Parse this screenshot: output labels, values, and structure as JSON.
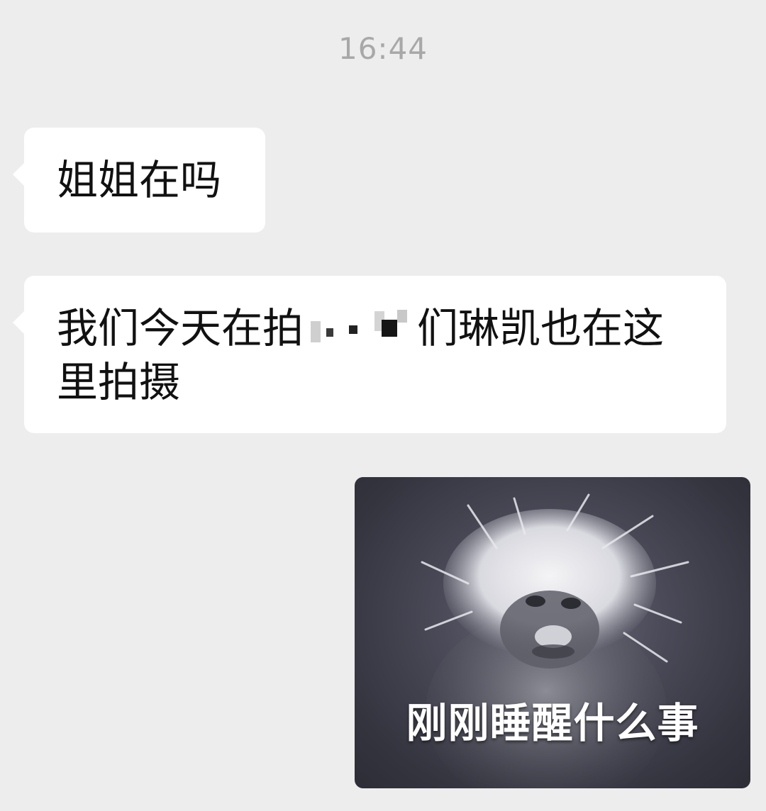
{
  "chat": {
    "timestamp": "16:44",
    "messages": [
      {
        "sender": "other",
        "type": "text",
        "text": "姐姐在吗"
      },
      {
        "sender": "other",
        "type": "text",
        "text_before": "我们今天在拍",
        "text_after": "们琳凯也在这里拍摄",
        "redacted": true
      },
      {
        "sender": "self",
        "type": "image",
        "caption": "刚刚睡醒什么事"
      }
    ]
  },
  "colors": {
    "background": "#ededed",
    "bubble": "#ffffff",
    "timestamp": "#a8a8a8"
  }
}
